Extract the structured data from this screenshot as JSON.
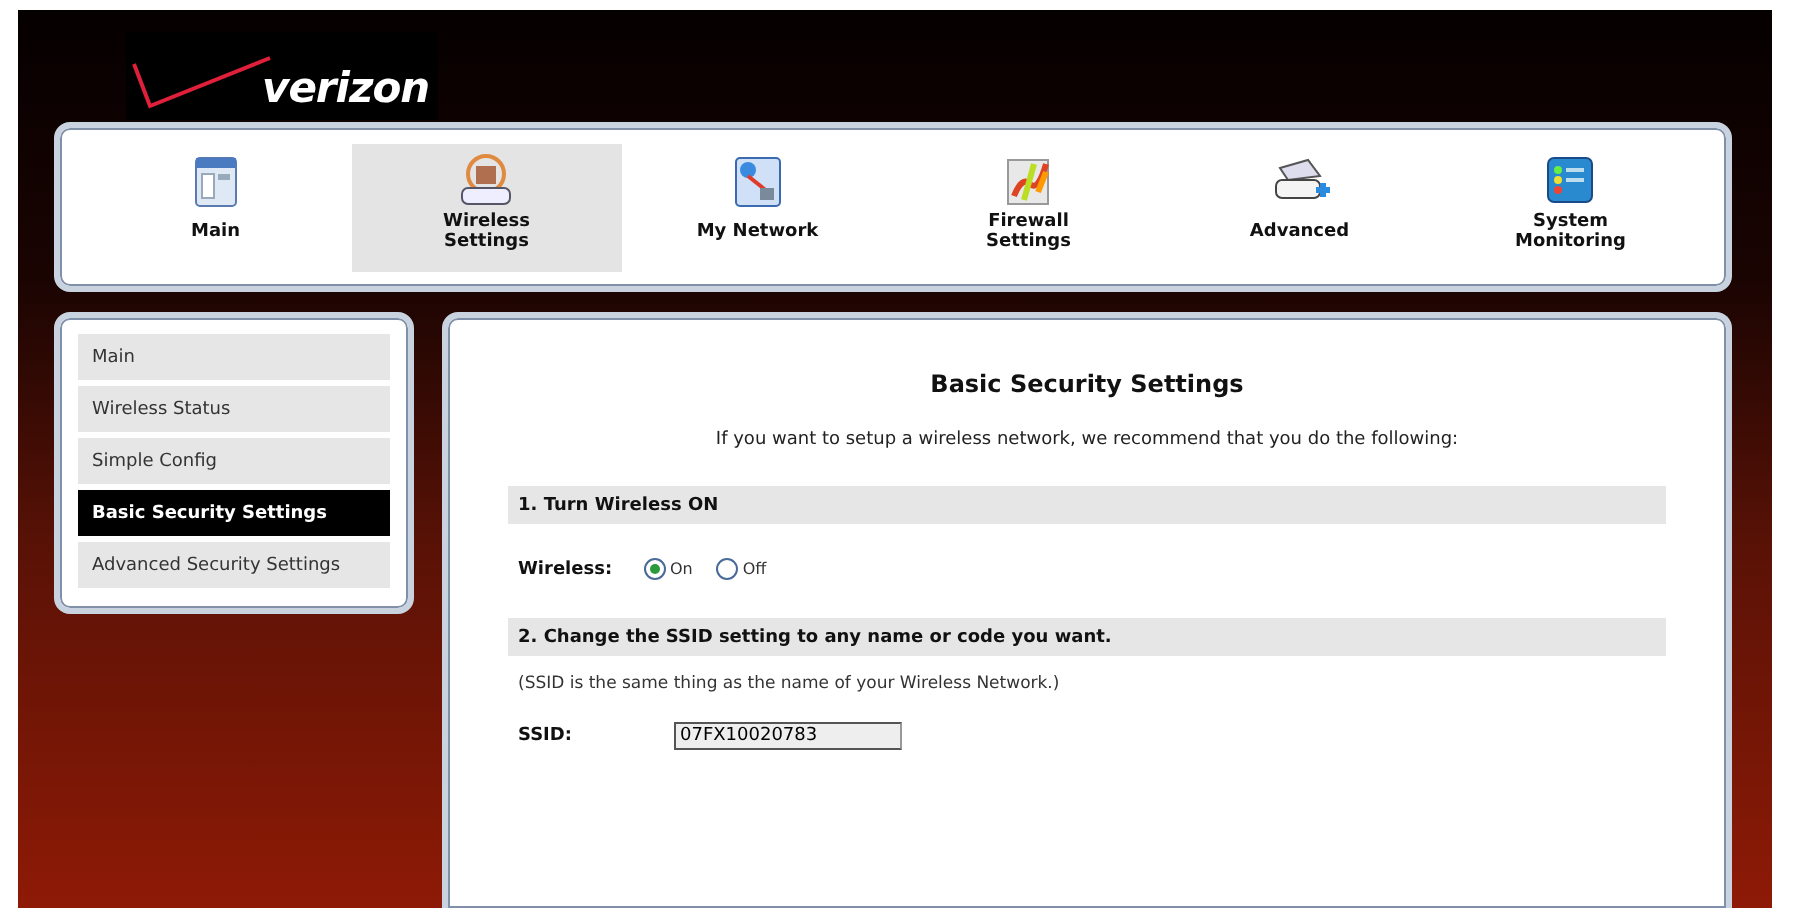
{
  "logo": {
    "text": "verizon"
  },
  "nav_tabs": [
    {
      "label": "Main",
      "selected": false
    },
    {
      "label": "Wireless Settings",
      "selected": true
    },
    {
      "label": "My Network",
      "selected": false
    },
    {
      "label": "Firewall Settings",
      "selected": false
    },
    {
      "label": "Advanced",
      "selected": false
    },
    {
      "label": "System Monitoring",
      "selected": false
    }
  ],
  "sidebar": {
    "items": [
      {
        "label": "Main",
        "selected": false
      },
      {
        "label": "Wireless Status",
        "selected": false
      },
      {
        "label": "Simple Config",
        "selected": false
      },
      {
        "label": "Basic Security Settings",
        "selected": true
      },
      {
        "label": "Advanced Security Settings",
        "selected": false
      }
    ]
  },
  "content": {
    "title": "Basic Security Settings",
    "intro": "If you want to setup a wireless network, we recommend that you do the following:",
    "step_1": {
      "heading": "1. Turn Wireless ON",
      "field_label": "Wireless:",
      "options": [
        {
          "label": "On",
          "selected": true
        },
        {
          "label": "Off",
          "selected": false
        }
      ]
    },
    "step_2": {
      "heading": "2. Change the SSID setting to any name or code you want.",
      "note": "(SSID is the same thing as the name of your Wireless Network.)",
      "field_label": "SSID:",
      "value": "07FX10020783"
    }
  }
}
